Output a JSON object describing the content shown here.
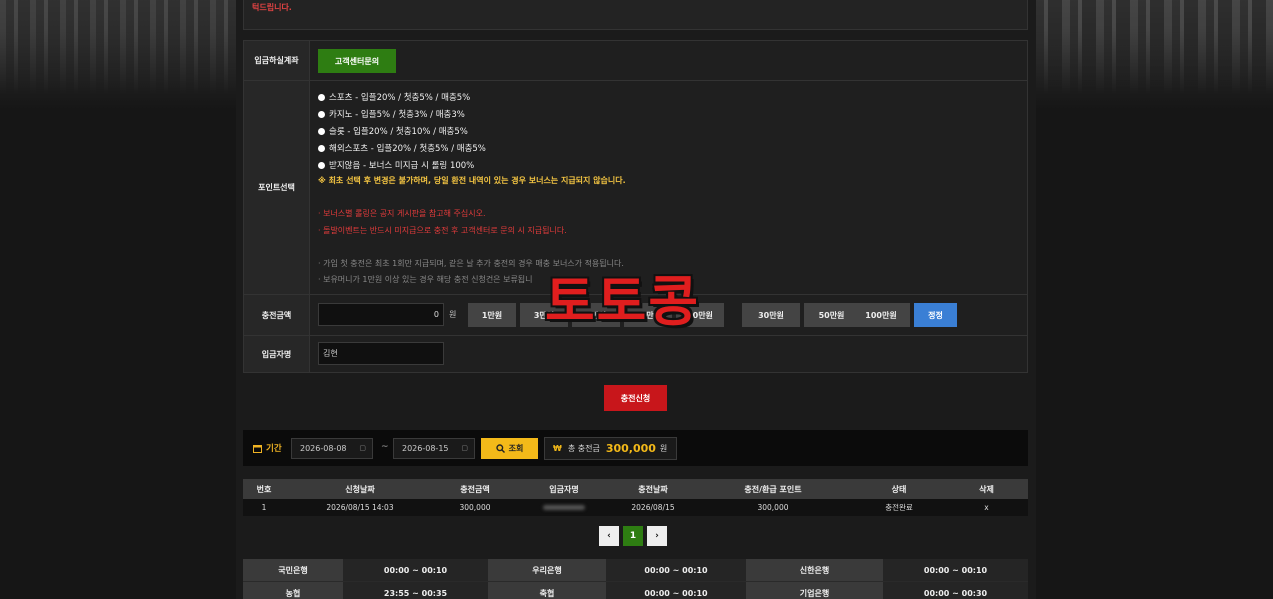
{
  "top_notice": "턱드립니다.",
  "form": {
    "deposit_account": {
      "label": "입금하실계좌",
      "button": "고객센터문의"
    },
    "point_select": {
      "label": "포인트선택",
      "options": [
        "스포츠 - 입플20% / 첫충5% / 매충5%",
        "카지노 - 입플5% / 첫충3% / 매충3%",
        "슬롯 - 입플20% / 첫충10% / 매충5%",
        "해외스포츠 - 입플20% / 첫충5% / 매충5%",
        "받지않음 - 보너스 미지급 시 롤링 100%"
      ],
      "warning": "※ 최초 선택 후 변경은 불가하며, 당일 환전 내역이 있는 경우 보너스는 지급되지 않습니다.",
      "red_notes": [
        "· 보너스별 롤링은 공지 게시판을 참고해 주십시오.",
        "· 돌발이벤트는 반드시 미지급으로 충전 후 고객센터로 문의 시 지급됩니다."
      ],
      "gray_notes": [
        "· 가입 첫 충전은 최초 1회만 지급되며, 같은 날 추가 충전의 경우 매충 보너스가 적용됩니다.",
        "· 보유머니가 1만원 이상 있는 경우 해당 충전 신청건은 보류됩니"
      ]
    },
    "charge_amount": {
      "label": "충전금액",
      "value": "0",
      "unit": "원",
      "buttons": [
        "1만원",
        "3만원",
        "5만원",
        "10만원",
        "20만원",
        "30만원",
        "50만원",
        "100만원"
      ],
      "reset": "정정"
    },
    "depositor": {
      "label": "입금자명",
      "value": "김현"
    }
  },
  "submit_label": "충전신청",
  "filter": {
    "period_label": "기간",
    "date_from": "2026-08-08",
    "date_to": "2026-08-15",
    "separator": "~",
    "search_label": "조회",
    "total_label": "총 충전금",
    "total_value": "300,000",
    "total_unit": "원",
    "won_sign": "₩"
  },
  "history": {
    "columns": [
      "번호",
      "신청날짜",
      "충전금액",
      "입금자명",
      "충전날짜",
      "충전/환급 포인트",
      "상태",
      "삭제"
    ],
    "rows": [
      {
        "no": "1",
        "request_date": "2026/08/15 14:03",
        "amount": "300,000",
        "charge_date": "2026/08/15",
        "points": "300,000",
        "status": "충전완료",
        "delete": "x"
      }
    ]
  },
  "pagination": {
    "prev": "‹",
    "current": "1",
    "next": "›"
  },
  "banks": [
    [
      {
        "bank": "국민은행",
        "time": "00:00 ~ 00:10"
      },
      {
        "bank": "우리은행",
        "time": "00:00 ~ 00:10"
      },
      {
        "bank": "신한은행",
        "time": "00:00 ~ 00:10"
      }
    ],
    [
      {
        "bank": "농협",
        "time": "23:55 ~ 00:35"
      },
      {
        "bank": "축협",
        "time": "00:00 ~ 00:10"
      },
      {
        "bank": "기업은행",
        "time": "00:00 ~ 00:30"
      }
    ]
  ],
  "watermark": "토토콩",
  "colors": {
    "accent_green": "#2e7d12",
    "accent_red": "#c8161b",
    "accent_yellow": "#f3b919",
    "accent_blue": "#3a7fd5"
  }
}
